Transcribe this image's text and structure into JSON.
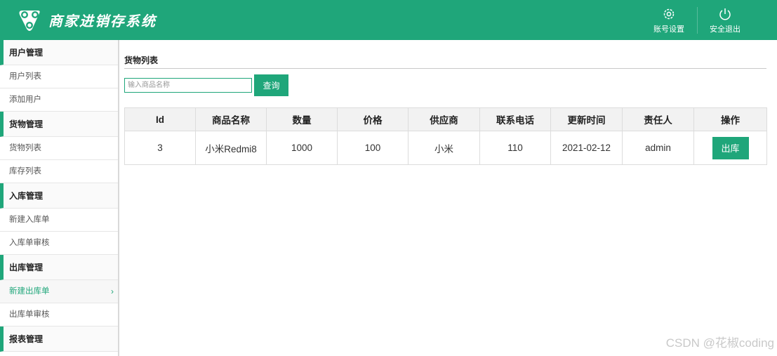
{
  "header": {
    "app_title": "商家进销存系统",
    "account_settings_label": "账号设置",
    "logout_label": "安全退出"
  },
  "sidebar": {
    "groups": [
      {
        "title": "用户管理",
        "items": [
          "用户列表",
          "添加用户"
        ]
      },
      {
        "title": "货物管理",
        "items": [
          "货物列表",
          "库存列表"
        ]
      },
      {
        "title": "入库管理",
        "items": [
          "新建入库单",
          "入库单审核"
        ]
      },
      {
        "title": "出库管理",
        "items": [
          "新建出库单",
          "出库单审核"
        ]
      },
      {
        "title": "报表管理",
        "items": []
      }
    ],
    "active_item": "新建出库单"
  },
  "main": {
    "page_title": "货物列表",
    "search": {
      "placeholder": "输入商品名称",
      "value": "",
      "button_label": "查询"
    },
    "table": {
      "columns": [
        "Id",
        "商品名称",
        "数量",
        "价格",
        "供应商",
        "联系电话",
        "更新时间",
        "责任人",
        "操作"
      ],
      "rows": [
        {
          "id": "3",
          "name": "小米Redmi8",
          "quantity": "1000",
          "price": "100",
          "supplier": "小米",
          "phone": "110",
          "updated": "2021-02-12",
          "owner": "admin",
          "action_label": "出库"
        }
      ]
    }
  },
  "watermark": "CSDN @花椒coding",
  "colors": {
    "brand": "#1fa67a",
    "header_bg": "#1fa67a",
    "table_head_bg": "#f2f2f2"
  }
}
